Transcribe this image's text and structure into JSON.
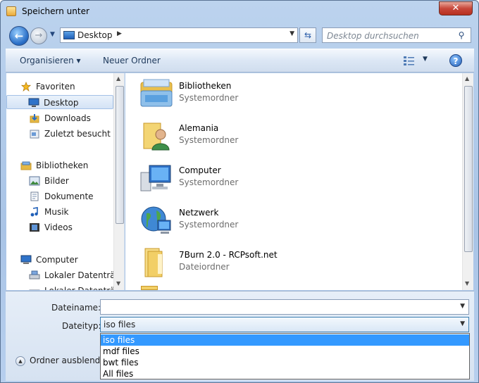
{
  "window": {
    "title": "Speichern unter",
    "close_label": "✕"
  },
  "address": {
    "location": "Desktop",
    "search_placeholder": "Desktop durchsuchen"
  },
  "toolbar": {
    "organize_label": "Organisieren ▾",
    "new_folder_label": "Neuer Ordner",
    "help_label": "?"
  },
  "nav": {
    "items": [
      {
        "label": "Favoriten",
        "icon": "star-icon"
      },
      {
        "label": "Desktop",
        "icon": "desktop-icon"
      },
      {
        "label": "Downloads",
        "icon": "downloads-icon"
      },
      {
        "label": "Zuletzt besucht",
        "icon": "recent-places-icon"
      },
      {
        "label": "Bibliotheken",
        "icon": "libraries-icon"
      },
      {
        "label": "Bilder",
        "icon": "pictures-icon"
      },
      {
        "label": "Dokumente",
        "icon": "documents-icon"
      },
      {
        "label": "Musik",
        "icon": "music-icon"
      },
      {
        "label": "Videos",
        "icon": "videos-icon"
      },
      {
        "label": "Computer",
        "icon": "computer-icon"
      },
      {
        "label": "Lokaler Datenträg",
        "icon": "drive-icon"
      },
      {
        "label": "Lokaler Datenträ",
        "icon": "drive-icon"
      }
    ]
  },
  "files": [
    {
      "name": "Bibliotheken",
      "type": "Systemordner",
      "icon": "libraries-folder-icon"
    },
    {
      "name": "Alemania",
      "type": "Systemordner",
      "icon": "user-folder-icon"
    },
    {
      "name": "Computer",
      "type": "Systemordner",
      "icon": "computer-icon"
    },
    {
      "name": "Netzwerk",
      "type": "Systemordner",
      "icon": "network-icon"
    },
    {
      "name": "7Burn 2.0 - RCPsoft.net",
      "type": "Dateiordner",
      "icon": "folder-icon"
    }
  ],
  "form": {
    "filename_label": "Dateiname:",
    "filename_value": "",
    "filetype_label": "Dateityp:",
    "filetype_value": "iso files",
    "filetype_options": [
      "iso files",
      "mdf files",
      "bwt files",
      "All files"
    ],
    "toggle_folders_label": "Ordner ausblenden"
  },
  "colors": {
    "selection": "#3399ff",
    "accent": "#2a6fc7"
  }
}
